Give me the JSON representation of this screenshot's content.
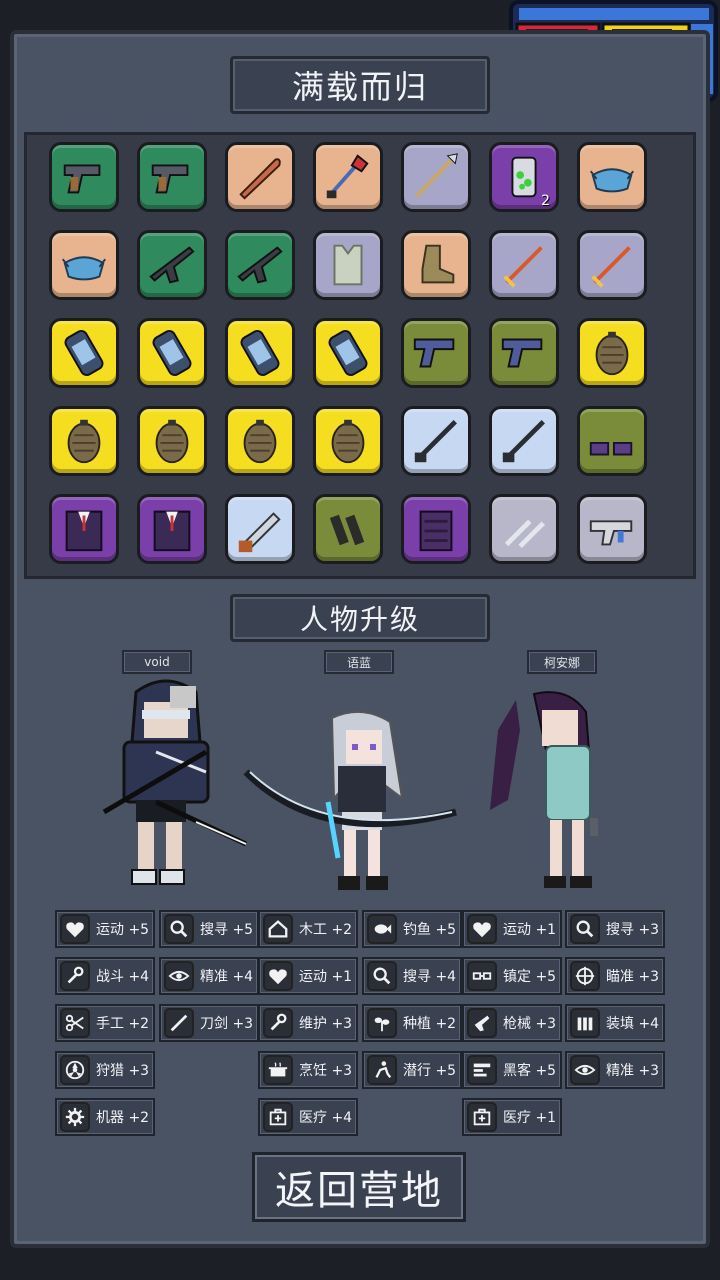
{
  "screen": {
    "loot_title": "满载而归",
    "upgrade_title": "人物升级",
    "return_button": "返回营地"
  },
  "inventory": {
    "colors": {
      "green": "#2f8a5e",
      "tan": "#e7b48f",
      "lilac": "#a7a6c9",
      "purple": "#7a3fa8",
      "yellow": "#f4de1f",
      "olive": "#7a8c39",
      "ice": "#c7d8f3",
      "gray": "#b8b6c9"
    },
    "rows": [
      [
        {
          "bg": "green",
          "icon": "pistol-icon"
        },
        {
          "bg": "green",
          "icon": "pistol-icon"
        },
        {
          "bg": "tan",
          "icon": "bat-icon"
        },
        {
          "bg": "tan",
          "icon": "shovel-icon"
        },
        {
          "bg": "lilac",
          "icon": "spear-icon"
        },
        {
          "bg": "purple",
          "icon": "paint-can-icon",
          "qty": "2"
        },
        {
          "bg": "tan",
          "icon": "mask-icon"
        }
      ],
      [
        {
          "bg": "tan",
          "icon": "mask-icon"
        },
        {
          "bg": "green",
          "icon": "rifle-icon"
        },
        {
          "bg": "green",
          "icon": "rifle-icon"
        },
        {
          "bg": "lilac",
          "icon": "vest-icon"
        },
        {
          "bg": "tan",
          "icon": "boot-icon"
        },
        {
          "bg": "lilac",
          "icon": "sword-icon"
        },
        {
          "bg": "lilac",
          "icon": "sword-icon"
        }
      ],
      [
        {
          "bg": "yellow",
          "icon": "canister-icon"
        },
        {
          "bg": "yellow",
          "icon": "canister-icon"
        },
        {
          "bg": "yellow",
          "icon": "canister-icon"
        },
        {
          "bg": "yellow",
          "icon": "canister-icon"
        },
        {
          "bg": "olive",
          "icon": "handgun-icon"
        },
        {
          "bg": "olive",
          "icon": "handgun-icon"
        },
        {
          "bg": "yellow",
          "icon": "grenade-icon"
        }
      ],
      [
        {
          "bg": "yellow",
          "icon": "grenade-icon"
        },
        {
          "bg": "yellow",
          "icon": "grenade-icon"
        },
        {
          "bg": "yellow",
          "icon": "grenade-icon"
        },
        {
          "bg": "yellow",
          "icon": "grenade-icon"
        },
        {
          "bg": "ice",
          "icon": "shotgun-icon"
        },
        {
          "bg": "ice",
          "icon": "shotgun-icon"
        },
        {
          "bg": "olive",
          "icon": "shoes-icon"
        }
      ],
      [
        {
          "bg": "purple",
          "icon": "suit-icon"
        },
        {
          "bg": "purple",
          "icon": "suit-icon"
        },
        {
          "bg": "ice",
          "icon": "chainsaw-icon"
        },
        {
          "bg": "olive",
          "icon": "magazine-icon"
        },
        {
          "bg": "purple",
          "icon": "armor-icon"
        },
        {
          "bg": "gray",
          "icon": "knives-icon"
        },
        {
          "bg": "gray",
          "icon": "smg-icon"
        }
      ]
    ]
  },
  "characters": [
    {
      "name": "void"
    },
    {
      "name": "语蓝"
    },
    {
      "name": "柯安娜"
    }
  ],
  "stats": {
    "col0": [
      {
        "icon": "heart-icon",
        "label": "运动 +5"
      },
      {
        "icon": "wrench-icon",
        "label": "战斗 +4"
      },
      {
        "icon": "scissors-icon",
        "label": "手工 +2"
      },
      {
        "icon": "hazard-icon",
        "label": "狩猎 +3"
      },
      {
        "icon": "gear-icon",
        "label": "机器 +2"
      }
    ],
    "col1": [
      {
        "icon": "magnifier-icon",
        "label": "搜寻 +5"
      },
      {
        "icon": "eye-icon",
        "label": "精准 +4"
      },
      {
        "icon": "blade-icon",
        "label": "刀剑 +3"
      }
    ],
    "col2": [
      {
        "icon": "house-icon",
        "label": "木工 +2"
      },
      {
        "icon": "heart-icon",
        "label": "运动 +1"
      },
      {
        "icon": "wrench-icon",
        "label": "维护 +3"
      },
      {
        "icon": "pot-icon",
        "label": "烹饪 +3"
      },
      {
        "icon": "medkit-icon",
        "label": "医疗 +4"
      }
    ],
    "col3": [
      {
        "icon": "fish-icon",
        "label": "钓鱼 +5"
      },
      {
        "icon": "magnifier-icon",
        "label": "搜寻 +4"
      },
      {
        "icon": "plant-icon",
        "label": "种植 +2"
      },
      {
        "icon": "sneak-icon",
        "label": "潜行 +5"
      }
    ],
    "col4": [
      {
        "icon": "heart-icon",
        "label": "运动 +1"
      },
      {
        "icon": "glasses-icon",
        "label": "镇定 +5"
      },
      {
        "icon": "gun-icon",
        "label": "枪械 +3"
      },
      {
        "icon": "hacker-icon",
        "label": "黑客 +5"
      },
      {
        "icon": "medkit-icon",
        "label": "医疗 +1"
      }
    ],
    "col5": [
      {
        "icon": "magnifier-icon",
        "label": "搜寻 +3"
      },
      {
        "icon": "crosshair-icon",
        "label": "瞄准 +3"
      },
      {
        "icon": "bullets-icon",
        "label": "装填 +4"
      },
      {
        "icon": "eye-icon",
        "label": "精准 +3"
      }
    ]
  }
}
